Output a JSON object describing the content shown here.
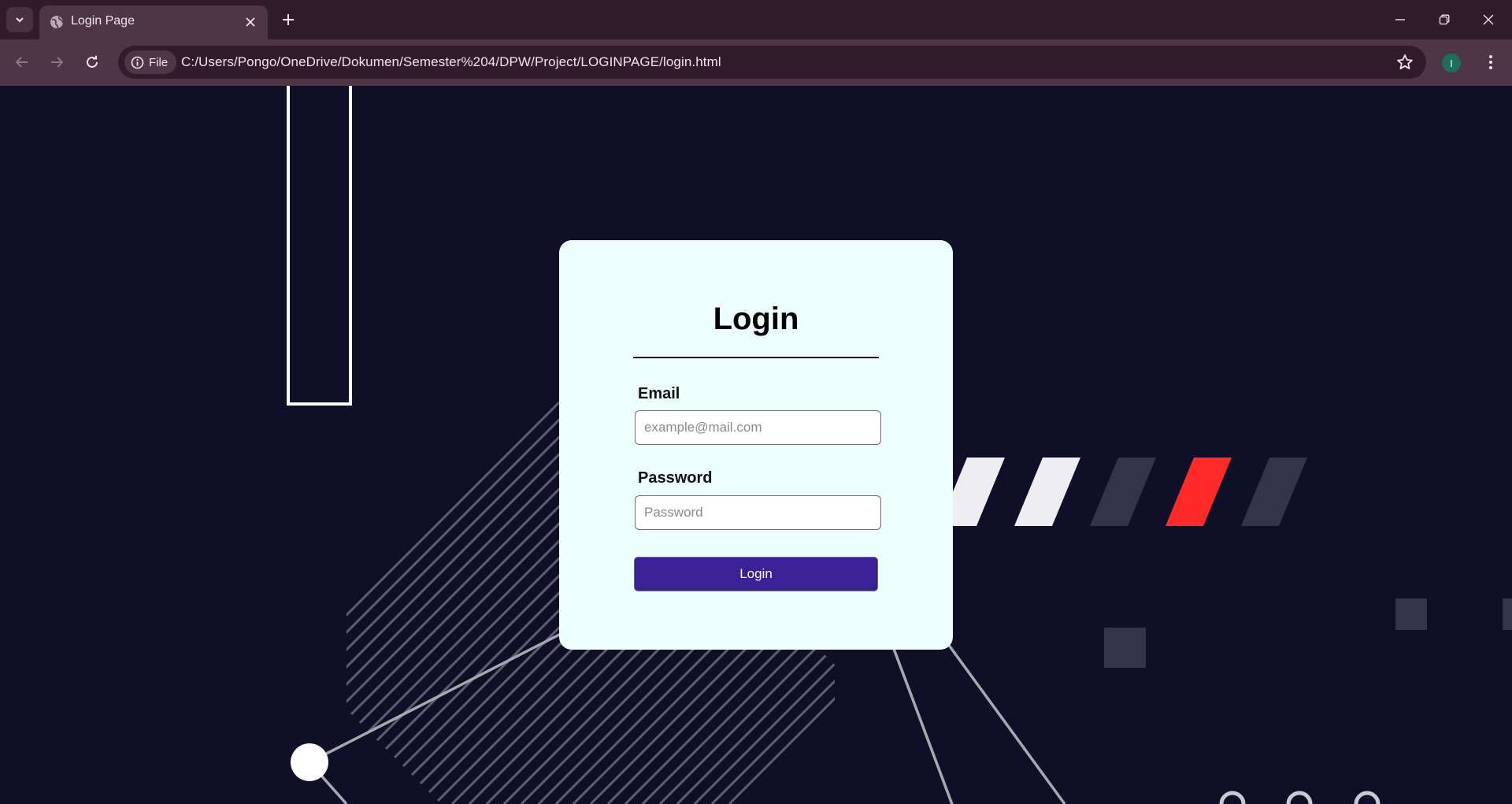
{
  "browser": {
    "tab_title": "Login Page",
    "chip_label": "File",
    "url": "C:/Users/Pongo/OneDrive/Dokumen/Semester%204/DPW/Project/LOGINPAGE/login.html",
    "profile_initial": "I",
    "icons": {
      "tab_list": "chevron-down-icon",
      "favicon": "globe-icon",
      "tab_close": "close-icon",
      "new_tab": "plus-icon",
      "minimize": "minimize-icon",
      "restore": "restore-icon",
      "close_window": "close-icon",
      "back": "arrow-left-icon",
      "forward": "arrow-right-icon",
      "reload": "reload-icon",
      "site_info": "info-icon",
      "bookmark": "star-icon",
      "menu": "kebab-menu-icon"
    }
  },
  "login": {
    "title": "Login",
    "email_label": "Email",
    "email_placeholder": "example@mail.com",
    "password_label": "Password",
    "password_placeholder": "Password",
    "submit_label": "Login"
  },
  "colors": {
    "page_background": "#0f1027",
    "card_background": "#edfffd",
    "button_background": "#3a2195",
    "accent_red": "#ff2b2b",
    "tab_bar": "#321c2b",
    "toolbar": "#4f3646"
  }
}
